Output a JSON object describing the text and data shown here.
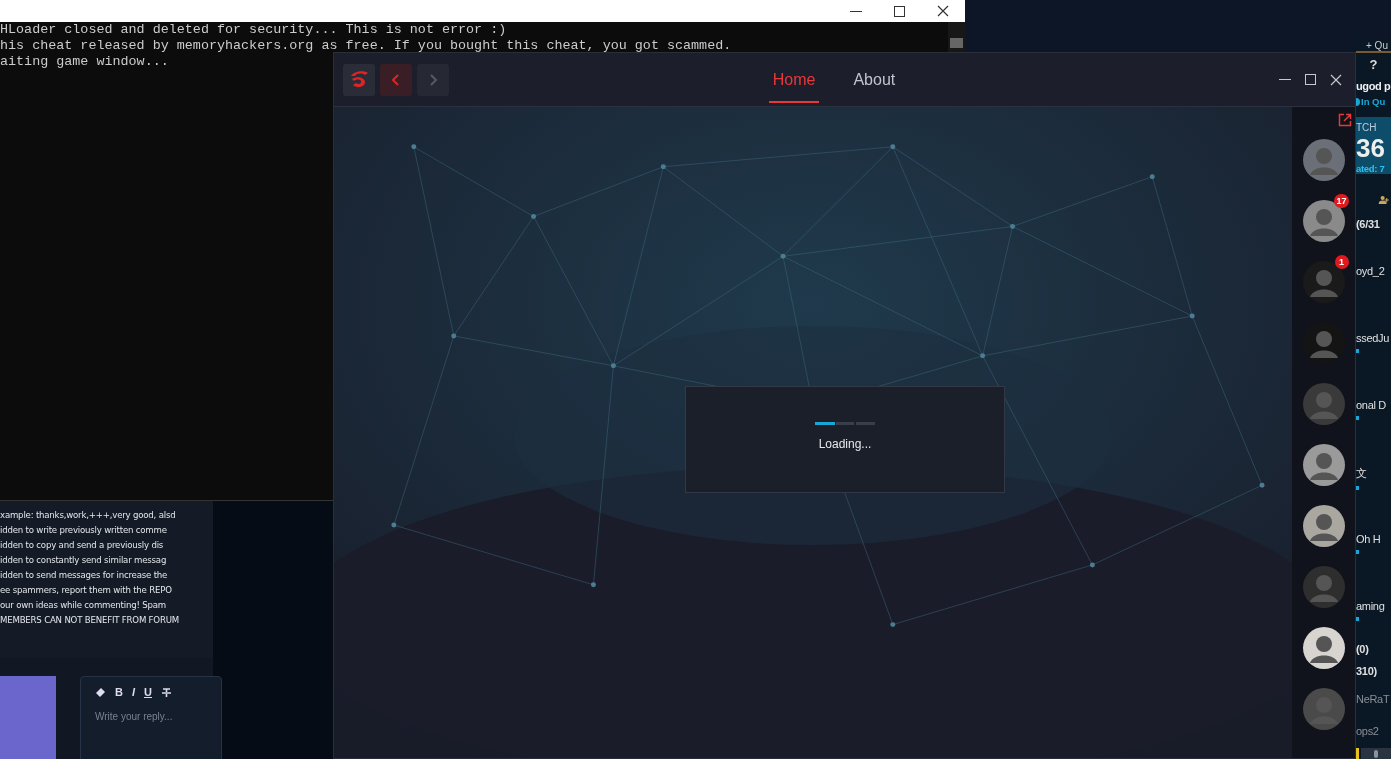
{
  "console": {
    "lines": [
      "HLoader closed and deleted for security... This is not error :)",
      "his cheat released by memoryhackers.org as free. If you bought this cheat, you got scammed.",
      "aiting game window..."
    ]
  },
  "forum": {
    "rules": [
      "xample: thanks,work,+++,very good, alsd",
      "idden to write previously written comme",
      "idden to copy and send a previously dis",
      "idden to constantly send similar messag",
      "idden to send messages for increase the",
      "ee spammers, report them with the REPO",
      "our own ideas while commenting! Spam",
      "MEMBERS CAN NOT BENEFIT FROM FORUM"
    ],
    "editor": {
      "tools": [
        {
          "kind": "eraser"
        },
        {
          "kind": "text",
          "label": "B"
        },
        {
          "kind": "text",
          "label": "I"
        },
        {
          "kind": "text",
          "label": "U"
        },
        {
          "kind": "strike"
        }
      ],
      "placeholder": "Write your reply..."
    }
  },
  "app": {
    "nav": {
      "back_disabled": false,
      "forward_disabled": true
    },
    "tabs": [
      {
        "label": "Home",
        "selected": true
      },
      {
        "label": "About",
        "selected": false
      }
    ],
    "loading": {
      "level": 0.33,
      "text": "Loading..."
    },
    "friends": [
      {
        "kind": "avatar"
      },
      {
        "kind": "avatar",
        "badge": "17"
      },
      {
        "kind": "avatar",
        "badge": "1"
      },
      {
        "kind": "avatar"
      },
      {
        "kind": "avatar"
      },
      {
        "kind": "avatar"
      },
      {
        "kind": "avatar"
      },
      {
        "kind": "avatar"
      },
      {
        "kind": "avatar"
      },
      {
        "kind": "avatar"
      }
    ]
  },
  "client": {
    "top_link": "+ Qu",
    "help": "?",
    "name": "ugod p",
    "status": "In Qu",
    "banner": {
      "label": "TCH",
      "value": "36",
      "sub": "ated: 7"
    },
    "entries": [
      {
        "kind": "group",
        "text": "(6/31"
      },
      {
        "kind": "friend",
        "text": "oyd_2",
        "sub": false
      },
      {
        "kind": "friend",
        "text": "ssedJu",
        "sub": true
      },
      {
        "kind": "friend",
        "text": "onal D",
        "sub": true
      },
      {
        "kind": "friend",
        "text": "文",
        "sub": true
      },
      {
        "kind": "friend",
        "text": "Oh H",
        "sub": true
      },
      {
        "kind": "friend",
        "text": "aming",
        "sub": true
      },
      {
        "kind": "group",
        "text": "(0)"
      },
      {
        "kind": "group",
        "text": "310)"
      },
      {
        "kind": "offline",
        "text": "NeRaT",
        "sub": false
      },
      {
        "kind": "offline",
        "text": "ops2",
        "sub": false
      }
    ]
  }
}
